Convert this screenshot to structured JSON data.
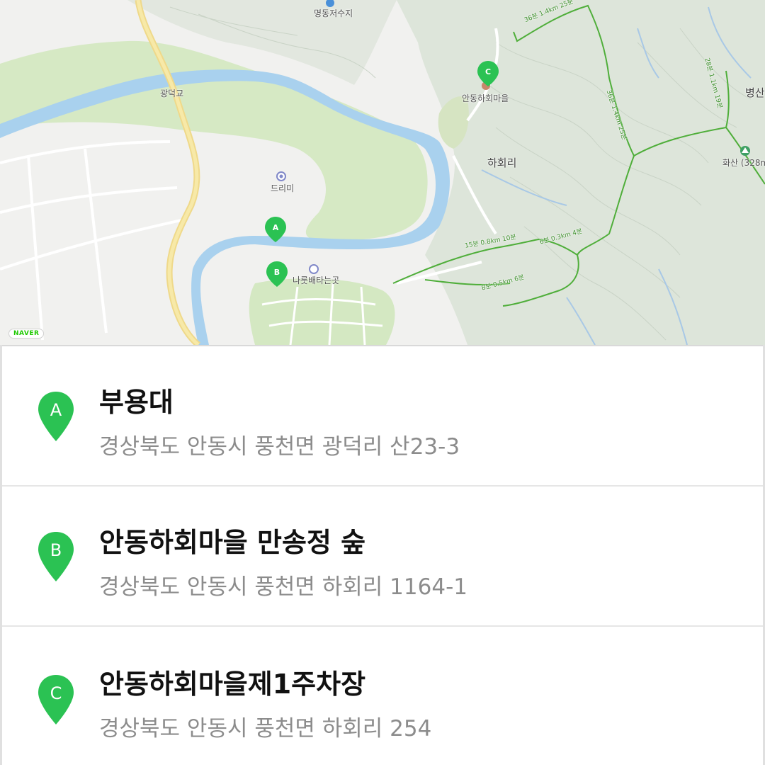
{
  "map": {
    "labels": {
      "reservoir": "명동저수지",
      "bridge": "광덕교",
      "village": "안동하회마을",
      "hahoe_ri": "하회리",
      "drimi": "드리미",
      "ferry": "나룻배타는곳",
      "mountain": "화산 (328m",
      "byeongsan": "병산"
    },
    "trail_labels": {
      "t1": "36분 1.4km 25분",
      "t2": "28분 1.1km 19분",
      "t3": "36분 1.4km 25분",
      "t4": "15분 0.8km 10분",
      "t5": "6분 0.3km 4분",
      "t6": "8분 0.5km 6분"
    },
    "logo": "NAVER",
    "pins": [
      {
        "letter": "A"
      },
      {
        "letter": "B"
      },
      {
        "letter": "C"
      }
    ],
    "colors": {
      "river": "#a9d1ee",
      "park": "#d3e8c0",
      "mountain": "#dfe6dc",
      "road": "#f6e08c",
      "trail": "#4fae3a",
      "pin": "#2bc253"
    }
  },
  "places": [
    {
      "letter": "A",
      "name": "부용대",
      "address": "경상북도 안동시 풍천면 광덕리 산23-3"
    },
    {
      "letter": "B",
      "name": "안동하회마을 만송정 숲",
      "address": "경상북도 안동시 풍천면 하회리 1164-1"
    },
    {
      "letter": "C",
      "name": "안동하회마을제1주차장",
      "address": "경상북도 안동시 풍천면 하회리 254"
    }
  ]
}
